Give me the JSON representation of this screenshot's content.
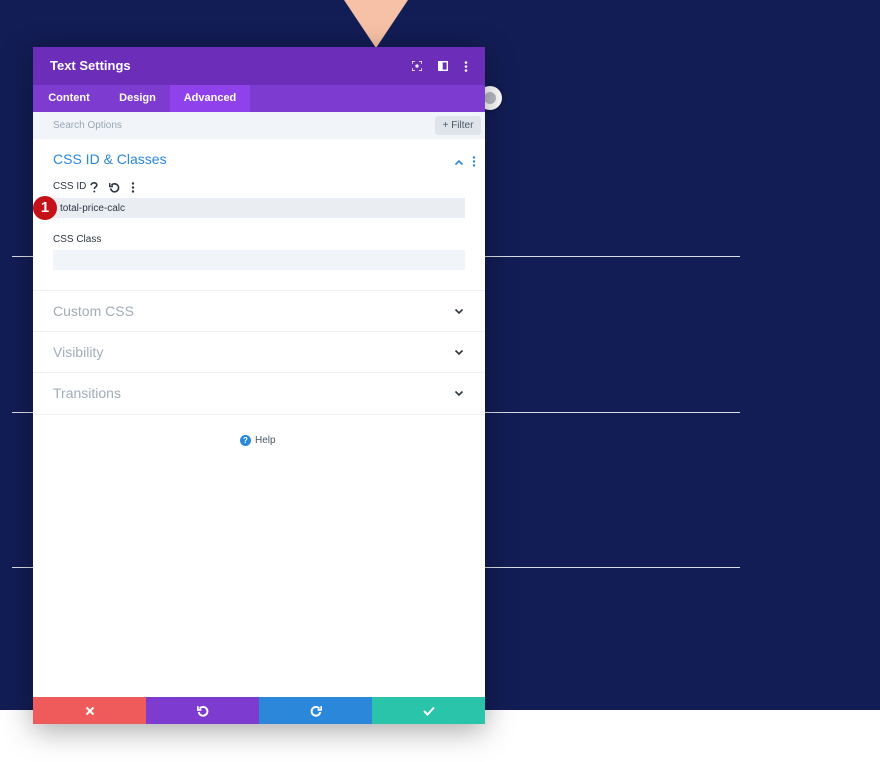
{
  "colors": {
    "page_background": "#131d55",
    "accent_triangle": "#f6c1a6",
    "header": "#6c2eb9",
    "tabs_bar": "#7e3bd0",
    "active_tab": "#8f42ec",
    "section_title": "#2b87da",
    "badge": "#c4111a",
    "footer_discard": "#ef5b5b",
    "footer_undo": "#7e3bd0",
    "footer_redo": "#2b87da",
    "footer_save": "#29c4a9"
  },
  "modal": {
    "title": "Text Settings",
    "header_icons": [
      "focus-icon",
      "split-view-icon",
      "more-options-icon"
    ]
  },
  "tabs": [
    {
      "label": "Content",
      "active": false
    },
    {
      "label": "Design",
      "active": false
    },
    {
      "label": "Advanced",
      "active": true
    }
  ],
  "search": {
    "placeholder": "Search Options",
    "filter_label": "+ Filter"
  },
  "css_section": {
    "title": "CSS ID & Classes",
    "css_id_label": "CSS ID",
    "css_id_value": "total-price-calc",
    "css_class_label": "CSS Class",
    "css_class_value": "",
    "step_badge": "1"
  },
  "collapsed_sections": [
    "Custom CSS",
    "Visibility",
    "Transitions"
  ],
  "help_label": "Help",
  "footer_buttons": [
    "discard-icon",
    "undo-icon",
    "redo-icon",
    "save-icon"
  ]
}
